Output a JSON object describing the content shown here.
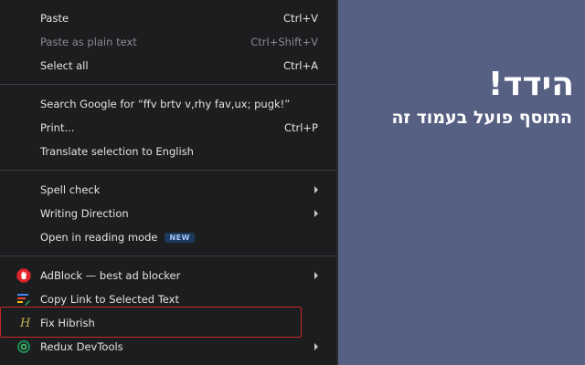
{
  "menu": {
    "items": [
      {
        "label": "Paste",
        "shortcut": "Ctrl+V"
      },
      {
        "label": "Paste as plain text",
        "shortcut": "Ctrl+Shift+V"
      },
      {
        "label": "Select all",
        "shortcut": "Ctrl+A"
      },
      {
        "label": "Search Google for “ffv brtv v,rhy fav,ux; pugk!”"
      },
      {
        "label": "Print...",
        "shortcut": "Ctrl+P"
      },
      {
        "label": "Translate selection to English"
      },
      {
        "label": "Spell check"
      },
      {
        "label": "Writing Direction"
      },
      {
        "label": "Open in reading mode",
        "badge": "NEW"
      },
      {
        "label": "AdBlock — best ad blocker"
      },
      {
        "label": "Copy Link to Selected Text"
      },
      {
        "label": "Fix Hibrish",
        "icon_text": "H"
      },
      {
        "label": "Redux DevTools"
      }
    ]
  },
  "icons": {
    "adblock": "adblock-hand-icon",
    "copy_link": "copy-link-icon",
    "hibrish": "hibrish-h-icon",
    "redux": "redux-devtools-icon",
    "submenu": "chevron-right-icon"
  },
  "promo": {
    "title": "הידד!",
    "subtitle": "התוסף פועל בעמוד זה"
  },
  "colors": {
    "menu_bg": "#1c1d1f",
    "page_bg": "#566082",
    "highlight_border": "#c9242b",
    "badge_bg": "#1d3a5e",
    "badge_text": "#a8c7fa"
  }
}
